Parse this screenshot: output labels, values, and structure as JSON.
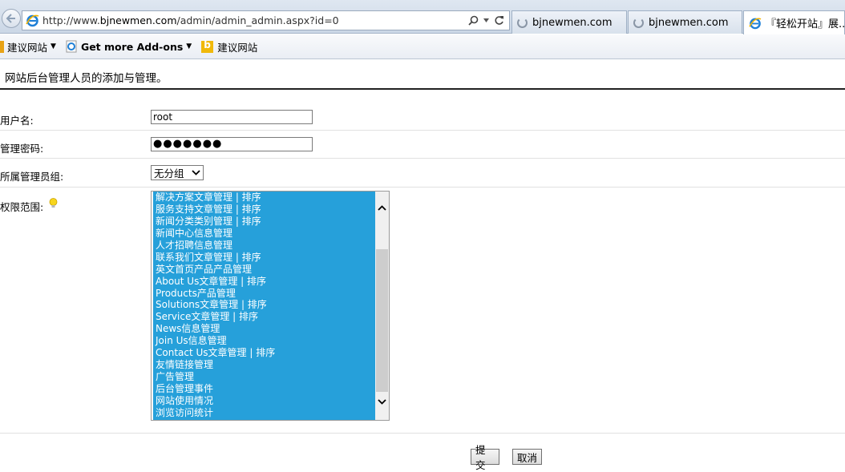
{
  "browser": {
    "address_prefix": "http://www.",
    "address_host": "bjnewmen.com",
    "address_path": "/admin/admin_admin.aspx?id=0",
    "tabs": [
      {
        "title": "bjnewmen.com"
      },
      {
        "title": "bjnewmen.com"
      },
      {
        "title": "『轻松开站』展..."
      }
    ]
  },
  "favorites": {
    "items": [
      {
        "label": "建议网站"
      },
      {
        "label": "Get more Add-ons"
      },
      {
        "label": "建议网站"
      }
    ]
  },
  "page": {
    "description": "网站后台管理人员的添加与管理。"
  },
  "form": {
    "username_label": "用户名:",
    "username_value": "root",
    "password_label": "管理密码:",
    "password_mask": "●●●●●●●",
    "group_label": "所属管理员组:",
    "group_value": "无分组",
    "permission_label": "权限范围:",
    "permission_options": [
      "解决方案文章管理 | 排序",
      "服务支持文章管理 | 排序",
      "新闻分类类别管理 | 排序",
      "新闻中心信息管理",
      "人才招聘信息管理",
      "联系我们文章管理 | 排序",
      "英文首页产品产品管理",
      "About Us文章管理 | 排序",
      "Products产品管理",
      "Solutions文章管理 | 排序",
      "Service文章管理 | 排序",
      "News信息管理",
      "Join Us信息管理",
      "Contact Us文章管理 | 排序",
      "友情链接管理",
      "广告管理",
      "后台管理事件",
      "网站使用情况",
      "浏览访问统计"
    ],
    "submit_label": "提交",
    "cancel_label": "取消"
  }
}
